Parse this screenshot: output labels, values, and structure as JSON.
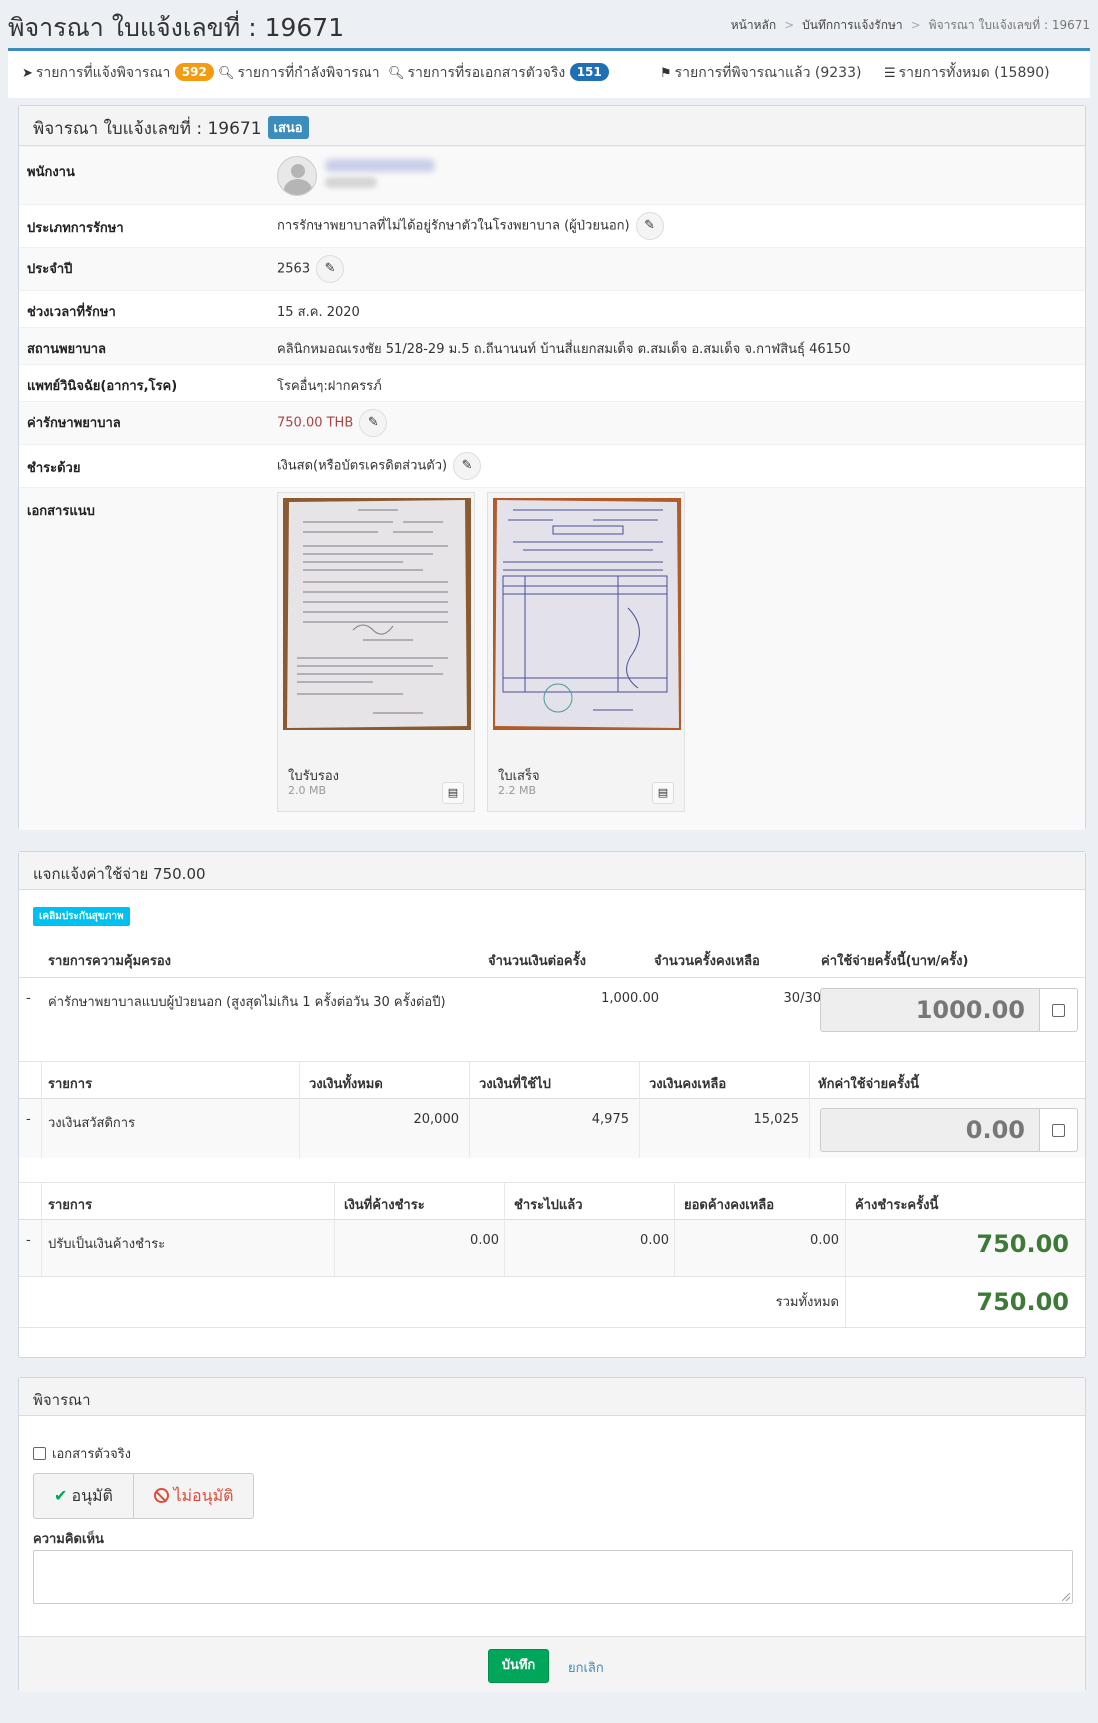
{
  "header": {
    "title": "พิจารณา ใบแจ้งเลขที่ : 19671",
    "breadcrumb": [
      "หน้าหลัก",
      "บันทึกการแจ้งรักษา",
      "พิจารณา ใบแจ้งเลขที่ : 19671"
    ]
  },
  "tabs": [
    {
      "label": "รายการที่แจ้งพิจารณา",
      "badge": "592",
      "icon": "paper-plane-icon"
    },
    {
      "label": "รายการที่กำลังพิจารณา",
      "icon": "search-icon"
    },
    {
      "label": "รายการที่รอเอกสารตัวจริง",
      "badge": "151",
      "icon": "search-icon"
    },
    {
      "label": "รายการที่พิจารณาแล้ว (9233)",
      "icon": "flag-icon"
    },
    {
      "label": "รายการทั้งหมด (15890)",
      "icon": "list-icon"
    }
  ],
  "detail": {
    "title": "พิจารณา ใบแจ้งเลขที่ : 19671",
    "status": "เสนอ",
    "rows": {
      "employee": {
        "label": "พนักงาน"
      },
      "treatment_type": {
        "label": "ประเภทการรักษา",
        "value": "การรักษาพยาบาลที่ไม่ได้อยู่รักษาตัวในโรงพยาบาล (ผู้ป่วยนอก)"
      },
      "year": {
        "label": "ประจำปี",
        "value": "2563"
      },
      "period": {
        "label": "ช่วงเวลาที่รักษา",
        "value": "15 ส.ค. 2020"
      },
      "hospital": {
        "label": "สถานพยาบาล",
        "value": "คลินิกหมอณเรงชัย 51/28-29 ม.5 ถ.ถีนานนท์ บ้านสี่แยกสมเด็จ ต.สมเด็จ อ.สมเด็จ จ.กาฬสินธุ์ 46150"
      },
      "diagnosis": {
        "label": "แพทย์วินิจฉัย(อาการ,โรค)",
        "value": "โรคอื่นๆ:ฝากครรภ์"
      },
      "cost": {
        "label": "ค่ารักษาพยาบาล",
        "value": "750.00 THB"
      },
      "payment": {
        "label": "ชำระด้วย",
        "value": "เงินสด(หรือบัตรเครดิตส่วนตัว)"
      },
      "attachments": {
        "label": "เอกสารแนบ"
      }
    },
    "attachments": [
      {
        "name": "ใบรับรอง",
        "size": "2.0 MB"
      },
      {
        "name": "ใบเสร็จ",
        "size": "2.2 MB"
      }
    ],
    "colors": {
      "cost": "#a94442",
      "status": "#3c8dbc"
    }
  },
  "expense": {
    "title": "แจกแจ้งค่าใช้จ่าย 750.00",
    "tag": "เคลิมประกันสุขภาพ",
    "coverage": {
      "headers": [
        "รายการความคุ้มครอง",
        "จำนวนเงินต่อครั้ง",
        "จำนวนครั้งคงเหลือ",
        "ค่าใช้จ่ายครั้งนี้(บาท/ครั้ง)"
      ],
      "row": {
        "bullet": "-",
        "name": "ค่ารักษาพยาบาลแบบผู้ป่วยนอก (สูงสุดไม่เกิน 1 ครั้งต่อวัน 30 ครั้งต่อปี)",
        "amount": "1,000.00",
        "remaining": "30/30",
        "input": "1000.00"
      }
    },
    "welfare": {
      "headers": [
        "รายการ",
        "วงเงินทั้งหมด",
        "วงเงินที่ใช้ไป",
        "วงเงินคงเหลือ",
        "หักค่าใช้จ่ายครั้งนี้"
      ],
      "row": {
        "bullet": "-",
        "name": "วงเงินสวัสดิการ",
        "total": "20,000",
        "used": "4,975",
        "remaining": "15,025",
        "input": "0.00"
      }
    },
    "outstanding": {
      "headers": [
        "รายการ",
        "เงินที่ค้างชำระ",
        "ชำระไปแล้ว",
        "ยอดค้างคงเหลือ",
        "ค้างชำระครั้งนี้"
      ],
      "row": {
        "bullet": "-",
        "name": "ปรับเป็นเงินค้างชำระ",
        "owed": "0.00",
        "paid": "0.00",
        "balance": "0.00",
        "this_time": "750.00"
      },
      "total_label": "รวมทั้งหมด",
      "total": "750.00"
    }
  },
  "consider": {
    "title": "พิจารณา",
    "original_doc_label": "เอกสารตัวจริง",
    "approve": "อนุมัติ",
    "reject": "ไม่อนุมัติ",
    "comment_label": "ความคิดเห็น",
    "save": "บันทึก",
    "cancel": "ยกเลิก"
  }
}
